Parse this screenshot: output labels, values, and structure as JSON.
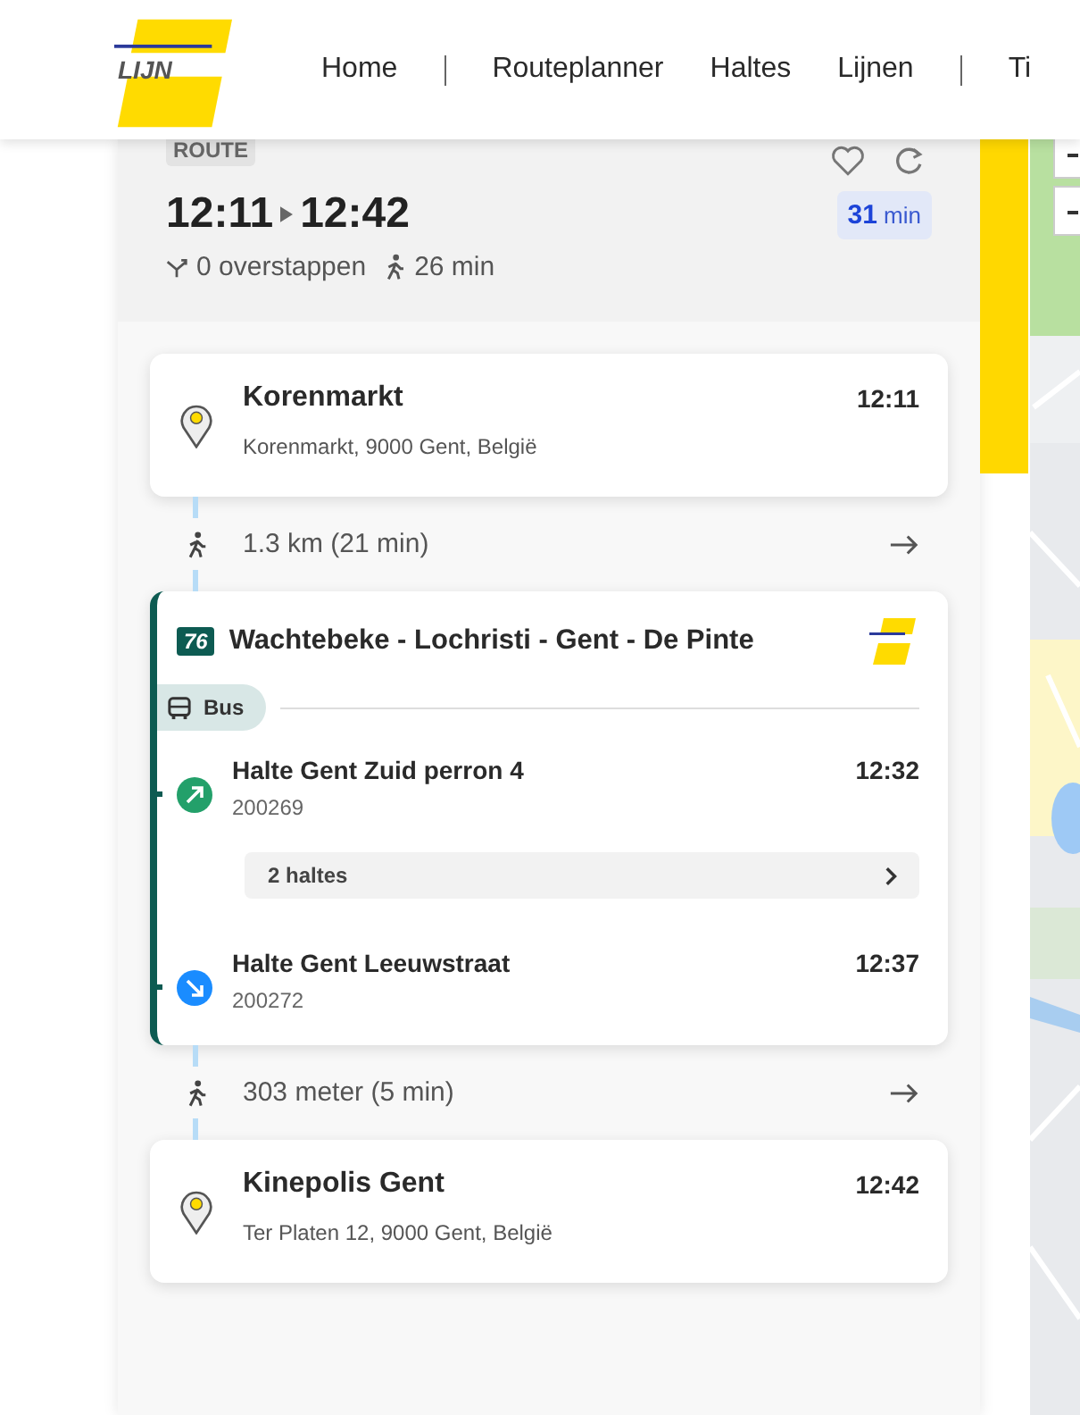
{
  "header": {
    "logo_text": "LIJN",
    "nav_groups": [
      {
        "links": [
          "Home"
        ]
      },
      {
        "links": [
          "Routeplanner",
          "Haltes",
          "Lijnen"
        ]
      },
      {
        "links": [
          "Ti"
        ]
      }
    ]
  },
  "route": {
    "badge": "ROUTE",
    "depart": "12:11",
    "arrive": "12:42",
    "duration_value": "31",
    "duration_unit": "min",
    "transfers": "0 overstappen",
    "walk": "26 min"
  },
  "legs": [
    {
      "kind": "place",
      "name": "Korenmarkt",
      "time": "12:11",
      "address": "Korenmarkt, 9000 Gent, België"
    },
    {
      "kind": "walk",
      "text": "1.3 km (21 min)"
    },
    {
      "kind": "bus",
      "line": "76",
      "destination": "Wachtebeke - Lochristi - Gent - De Pinte",
      "mode": "Bus",
      "board": {
        "name": "Halte Gent Zuid perron 4",
        "code": "200269",
        "time": "12:32"
      },
      "stops_between": "2 haltes",
      "alight": {
        "name": "Halte Gent Leeuwstraat",
        "code": "200272",
        "time": "12:37"
      }
    },
    {
      "kind": "walk",
      "text": "303 meter (5 min)"
    },
    {
      "kind": "place",
      "name": "Kinepolis Gent",
      "time": "12:42",
      "address": "Ter Platen 12, 9000 Gent, België"
    }
  ]
}
